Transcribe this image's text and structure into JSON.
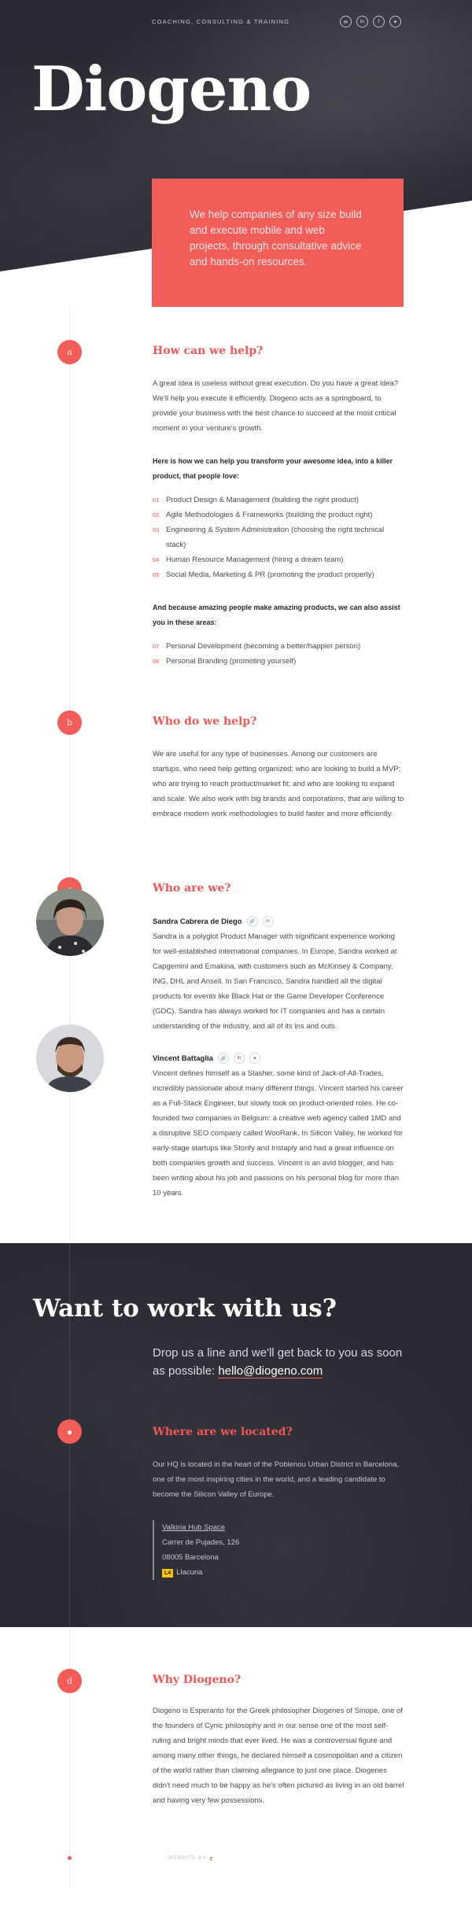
{
  "header": {
    "tagline": "COACHING, CONSULTING & TRAINING",
    "logo": "Diogeno",
    "social_icons": [
      "email-icon",
      "linkedin-icon",
      "facebook-icon",
      "twitter-icon"
    ],
    "intro": "We help companies of any size build and execute mobile and web projects, through consultative advice and hands-on resources."
  },
  "colors": {
    "accent": "#f25c59",
    "dark": "#2a2a33"
  },
  "sections": {
    "help": {
      "marker": "a",
      "title": "How can we help?",
      "intro": "A great idea is useless without great execution. Do you have a great idea? We'll help you execute it efficiently. Diogeno acts as a springboard, to provide your business with the best chance to succeed at the most critical moment in your venture's growth.",
      "lead1": "Here is how we can help you transform your awesome idea, into a killer product, that people love:",
      "list1": [
        {
          "n": "01",
          "text": "Product Design & Management (building the right product)"
        },
        {
          "n": "02",
          "text": "Agile Methodologies & Frameworks (building the product right)"
        },
        {
          "n": "03",
          "text": "Engineering & System Administration (choosing the right technical stack)"
        },
        {
          "n": "04",
          "text": "Human Resource Management (hiring a dream team)"
        },
        {
          "n": "05",
          "text": "Social Media, Marketing & PR (promoting the product properly)"
        }
      ],
      "lead2": "And because amazing people make amazing products, we can also assist you in these areas:",
      "list2": [
        {
          "n": "07",
          "text": "Personal Development (becoming a better/happier person)"
        },
        {
          "n": "08",
          "text": "Personal Branding (promoting yourself)"
        }
      ]
    },
    "who_help": {
      "marker": "b",
      "title": "Who do we help?",
      "text": "We are useful for any type of businesses. Among our customers are startups, who need help getting organized; who are looking to build a MVP; who are trying to reach product/market fit; and who are looking to expand and scale. We also work with big brands and corporations, that are willing to embrace modern work methodologies to build faster and more efficiently."
    },
    "who_are": {
      "marker": "c",
      "title": "Who are we?",
      "people": [
        {
          "name": "Sandra Cabrera de Diego",
          "icons": [
            "link-icon",
            "linkedin-icon"
          ],
          "bio": "Sandra is a polyglot Product Manager with significant experience working for well-established international companies. In Europe, Sandra worked at Capgemini and Emakina, with customers such as McKinsey & Company, ING, DHL and Ansell. In San Francisco, Sandra handled all the digital products for events like Black Hat or the Game Developer Conference (GDC). Sandra has always worked for IT companies and has a certain understanding of the industry, and all of its ins and outs."
        },
        {
          "name": "Vincent Battaglia",
          "icons": [
            "link-icon",
            "linkedin-icon",
            "twitter-icon"
          ],
          "bio": "Vincent defines himself as a Slasher, some kind of Jack-of-All-Trades, incredibly passionate about many different things. Vincent started his career as a Full-Stack Engineer, but slowly took on product-oriented roles. He co-founded two companies in Belgium: a creative web agency called 1MD and a disruptive SEO company called WooRank. In Silicon Valley, he worked for early-stage startups like Storify and Instaply and had a great influence on both companies growth and success. Vincent is an avid blogger, and has been writing about his job and passions on his personal blog for more than 10 years."
        }
      ]
    },
    "work": {
      "title": "Want to work with us?",
      "line": "Drop us a line and we'll get back to you as soon as possible:",
      "email": "hello@diogeno.com"
    },
    "location": {
      "icon": "map-pin-icon",
      "title": "Where are we located?",
      "text": "Our HQ is located in the heart of the Poblenou Urban District in Barcelona, one of the most inspiring cities in the world, and a leading candidate to become the Silicon Valley of Europe.",
      "address": [
        "Valkiria Hub Space",
        "Carrer de Pujades, 126",
        "08005 Barcelona"
      ],
      "metro_line": "L4",
      "metro_station": "Llacuna"
    },
    "why": {
      "marker": "d",
      "title": "Why Diogeno?",
      "text": "Diogeno is Esperanto for the Greek philosopher Diogenes of Sinope, one of the founders of Cynic philosophy and in our sense one of the most self-ruling and bright minds that ever lived. He was a controversial figure and among many other things, he declared himself a cosmopolitan and a citizen of the world rather than claiming allegiance to just one place. Diogenes didn't need much to be happy as he's often pictured as living in an old barrel and having very few possessions."
    }
  },
  "footer": {
    "credit": "WEBSITE BY",
    "mark": "r"
  }
}
